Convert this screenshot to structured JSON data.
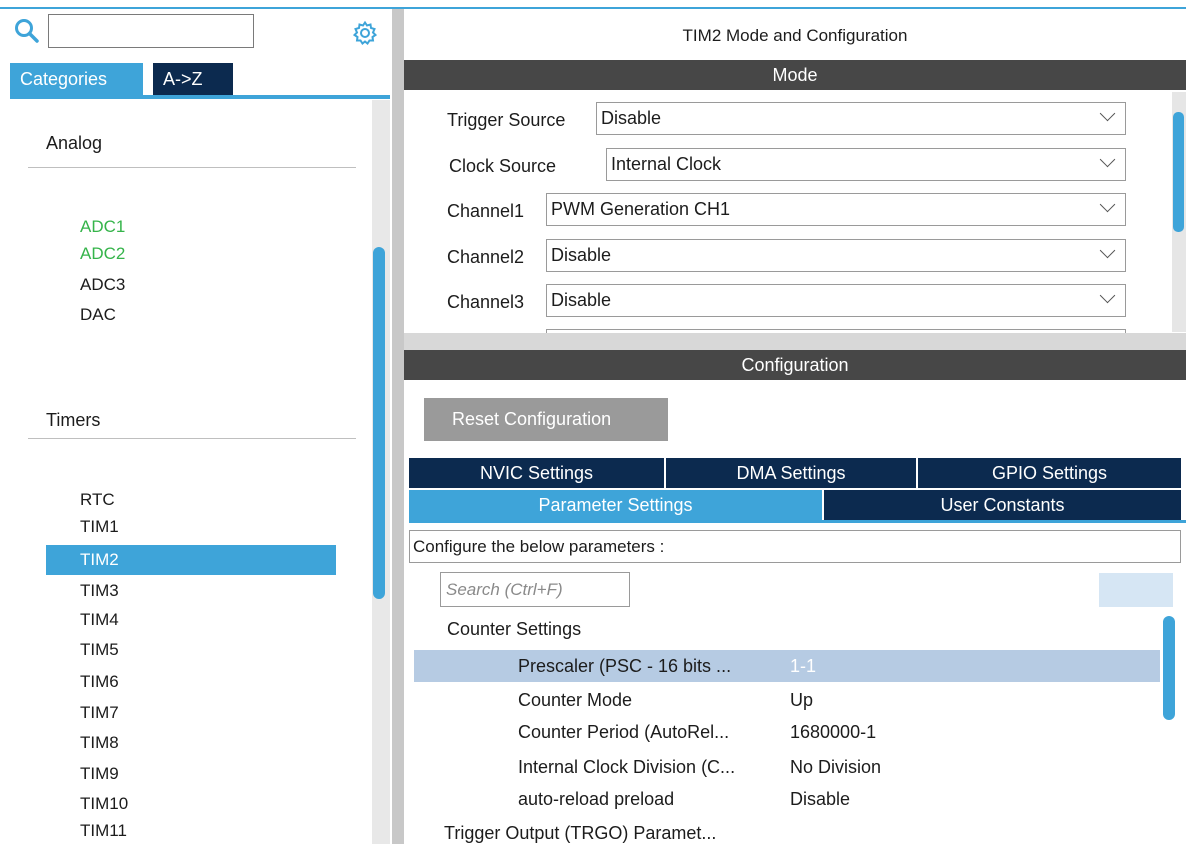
{
  "left": {
    "search": {
      "placeholder": ""
    },
    "tabs": {
      "categories": "Categories",
      "az": "A->Z"
    },
    "analog": {
      "header": "Analog",
      "items": [
        "ADC1",
        "ADC2",
        "ADC3",
        "DAC"
      ]
    },
    "timers": {
      "header": "Timers",
      "items": [
        "RTC",
        "TIM1",
        "TIM2",
        "TIM3",
        "TIM4",
        "TIM5",
        "TIM6",
        "TIM7",
        "TIM8",
        "TIM9",
        "TIM10",
        "TIM11"
      ]
    }
  },
  "right": {
    "title": "TIM2 Mode and Configuration",
    "mode_bar": "Mode",
    "mode_fields": {
      "trigger_label": "Trigger Source",
      "trigger_value": "Disable",
      "clock_label": "Clock Source",
      "clock_value": "Internal Clock",
      "ch1_label": "Channel1",
      "ch1_value": "PWM Generation CH1",
      "ch2_label": "Channel2",
      "ch2_value": "Disable",
      "ch3_label": "Channel3",
      "ch3_value": "Disable"
    },
    "config_bar": "Configuration",
    "reset_label": "Reset Configuration",
    "tabs": {
      "nvic": "NVIC Settings",
      "dma": "DMA Settings",
      "gpio": "GPIO Settings",
      "param": "Parameter Settings",
      "user": "User Constants"
    },
    "config_text": "Configure the below parameters :",
    "search_placeholder": "Search (Ctrl+F)",
    "counter_header": "Counter Settings",
    "params": [
      {
        "name": "Prescaler (PSC - 16 bits ...",
        "value": "1-1"
      },
      {
        "name": "Counter Mode",
        "value": "Up"
      },
      {
        "name": "Counter Period (AutoRel...",
        "value": "1680000-1"
      },
      {
        "name": "Internal Clock Division (C...",
        "value": "No Division"
      },
      {
        "name": "auto-reload preload",
        "value": "Disable"
      }
    ],
    "trgo_header": "Trigger Output (TRGO) Paramet..."
  },
  "colors": {
    "accent": "#3ea4d9",
    "navy": "#0c2a4f",
    "bar": "#474747",
    "green": "#35b44a"
  }
}
